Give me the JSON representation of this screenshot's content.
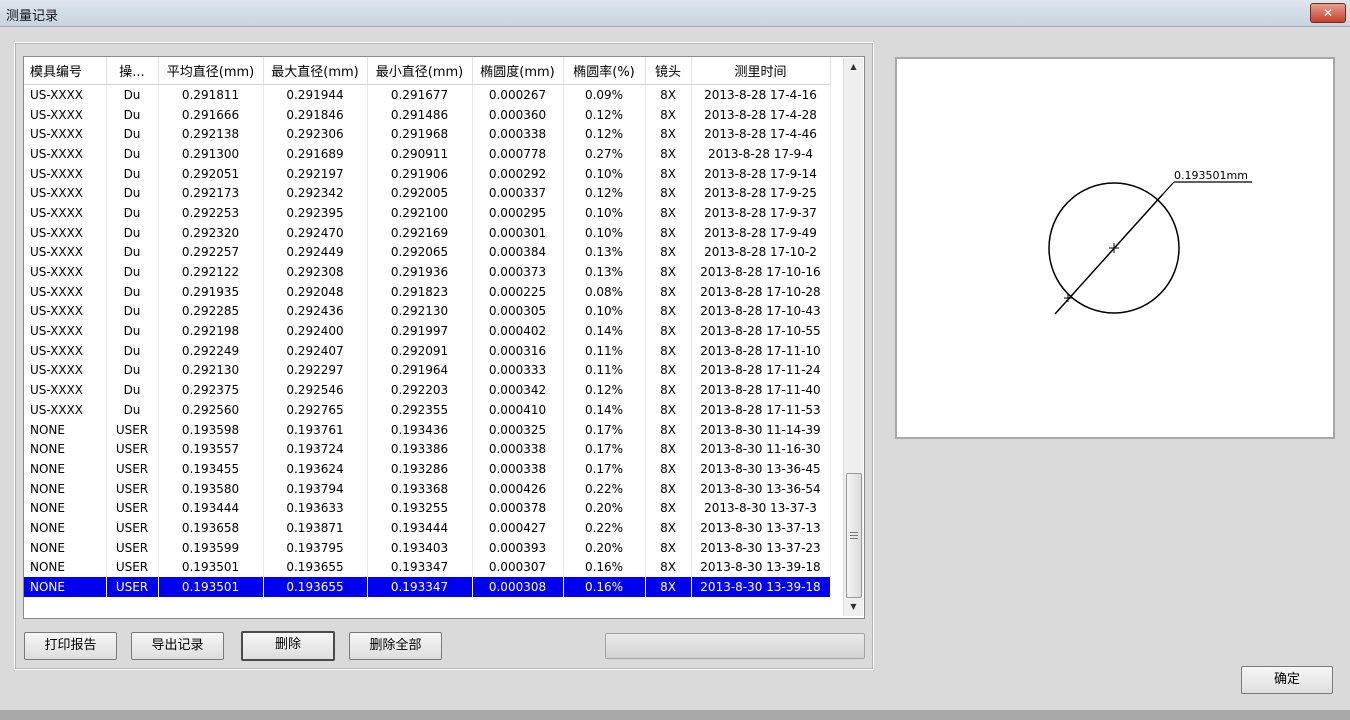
{
  "window": {
    "title": "测量记录",
    "close_label": "✕"
  },
  "table": {
    "columns": [
      "模具编号",
      "操...",
      "平均直径(mm)",
      "最大直径(mm)",
      "最小直径(mm)",
      "椭圆度(mm)",
      "椭圆率(%)",
      "镜头",
      "测里时间"
    ],
    "rows": [
      [
        "US-XXXX",
        "Du",
        "0.291811",
        "0.291944",
        "0.291677",
        "0.000267",
        "0.09%",
        "8X",
        "2013-8-28 17-4-16"
      ],
      [
        "US-XXXX",
        "Du",
        "0.291666",
        "0.291846",
        "0.291486",
        "0.000360",
        "0.12%",
        "8X",
        "2013-8-28 17-4-28"
      ],
      [
        "US-XXXX",
        "Du",
        "0.292138",
        "0.292306",
        "0.291968",
        "0.000338",
        "0.12%",
        "8X",
        "2013-8-28 17-4-46"
      ],
      [
        "US-XXXX",
        "Du",
        "0.291300",
        "0.291689",
        "0.290911",
        "0.000778",
        "0.27%",
        "8X",
        "2013-8-28 17-9-4"
      ],
      [
        "US-XXXX",
        "Du",
        "0.292051",
        "0.292197",
        "0.291906",
        "0.000292",
        "0.10%",
        "8X",
        "2013-8-28 17-9-14"
      ],
      [
        "US-XXXX",
        "Du",
        "0.292173",
        "0.292342",
        "0.292005",
        "0.000337",
        "0.12%",
        "8X",
        "2013-8-28 17-9-25"
      ],
      [
        "US-XXXX",
        "Du",
        "0.292253",
        "0.292395",
        "0.292100",
        "0.000295",
        "0.10%",
        "8X",
        "2013-8-28 17-9-37"
      ],
      [
        "US-XXXX",
        "Du",
        "0.292320",
        "0.292470",
        "0.292169",
        "0.000301",
        "0.10%",
        "8X",
        "2013-8-28 17-9-49"
      ],
      [
        "US-XXXX",
        "Du",
        "0.292257",
        "0.292449",
        "0.292065",
        "0.000384",
        "0.13%",
        "8X",
        "2013-8-28 17-10-2"
      ],
      [
        "US-XXXX",
        "Du",
        "0.292122",
        "0.292308",
        "0.291936",
        "0.000373",
        "0.13%",
        "8X",
        "2013-8-28 17-10-16"
      ],
      [
        "US-XXXX",
        "Du",
        "0.291935",
        "0.292048",
        "0.291823",
        "0.000225",
        "0.08%",
        "8X",
        "2013-8-28 17-10-28"
      ],
      [
        "US-XXXX",
        "Du",
        "0.292285",
        "0.292436",
        "0.292130",
        "0.000305",
        "0.10%",
        "8X",
        "2013-8-28 17-10-43"
      ],
      [
        "US-XXXX",
        "Du",
        "0.292198",
        "0.292400",
        "0.291997",
        "0.000402",
        "0.14%",
        "8X",
        "2013-8-28 17-10-55"
      ],
      [
        "US-XXXX",
        "Du",
        "0.292249",
        "0.292407",
        "0.292091",
        "0.000316",
        "0.11%",
        "8X",
        "2013-8-28 17-11-10"
      ],
      [
        "US-XXXX",
        "Du",
        "0.292130",
        "0.292297",
        "0.291964",
        "0.000333",
        "0.11%",
        "8X",
        "2013-8-28 17-11-24"
      ],
      [
        "US-XXXX",
        "Du",
        "0.292375",
        "0.292546",
        "0.292203",
        "0.000342",
        "0.12%",
        "8X",
        "2013-8-28 17-11-40"
      ],
      [
        "US-XXXX",
        "Du",
        "0.292560",
        "0.292765",
        "0.292355",
        "0.000410",
        "0.14%",
        "8X",
        "2013-8-28 17-11-53"
      ],
      [
        "NONE",
        "USER",
        "0.193598",
        "0.193761",
        "0.193436",
        "0.000325",
        "0.17%",
        "8X",
        "2013-8-30 11-14-39"
      ],
      [
        "NONE",
        "USER",
        "0.193557",
        "0.193724",
        "0.193386",
        "0.000338",
        "0.17%",
        "8X",
        "2013-8-30 11-16-30"
      ],
      [
        "NONE",
        "USER",
        "0.193455",
        "0.193624",
        "0.193286",
        "0.000338",
        "0.17%",
        "8X",
        "2013-8-30 13-36-45"
      ],
      [
        "NONE",
        "USER",
        "0.193580",
        "0.193794",
        "0.193368",
        "0.000426",
        "0.22%",
        "8X",
        "2013-8-30 13-36-54"
      ],
      [
        "NONE",
        "USER",
        "0.193444",
        "0.193633",
        "0.193255",
        "0.000378",
        "0.20%",
        "8X",
        "2013-8-30 13-37-3"
      ],
      [
        "NONE",
        "USER",
        "0.193658",
        "0.193871",
        "0.193444",
        "0.000427",
        "0.22%",
        "8X",
        "2013-8-30 13-37-13"
      ],
      [
        "NONE",
        "USER",
        "0.193599",
        "0.193795",
        "0.193403",
        "0.000393",
        "0.20%",
        "8X",
        "2013-8-30 13-37-23"
      ],
      [
        "NONE",
        "USER",
        "0.193501",
        "0.193655",
        "0.193347",
        "0.000307",
        "0.16%",
        "8X",
        "2013-8-30 13-39-18"
      ],
      [
        "NONE",
        "USER",
        "0.193501",
        "0.193655",
        "0.193347",
        "0.000308",
        "0.16%",
        "8X",
        "2013-8-30 13-39-18"
      ]
    ],
    "selected_row": 25,
    "selection_color": "#0000f0"
  },
  "buttons": {
    "print_report": "打印报告",
    "export_records": "导出记录",
    "delete": "删除",
    "delete_all": "删除全部",
    "ok": "确定"
  },
  "preview": {
    "diameter_label": "0.193501mm"
  },
  "icons": {
    "scroll_up": "scroll-up-arrow-icon",
    "scroll_down": "scroll-down-arrow-icon",
    "close": "close-icon"
  }
}
